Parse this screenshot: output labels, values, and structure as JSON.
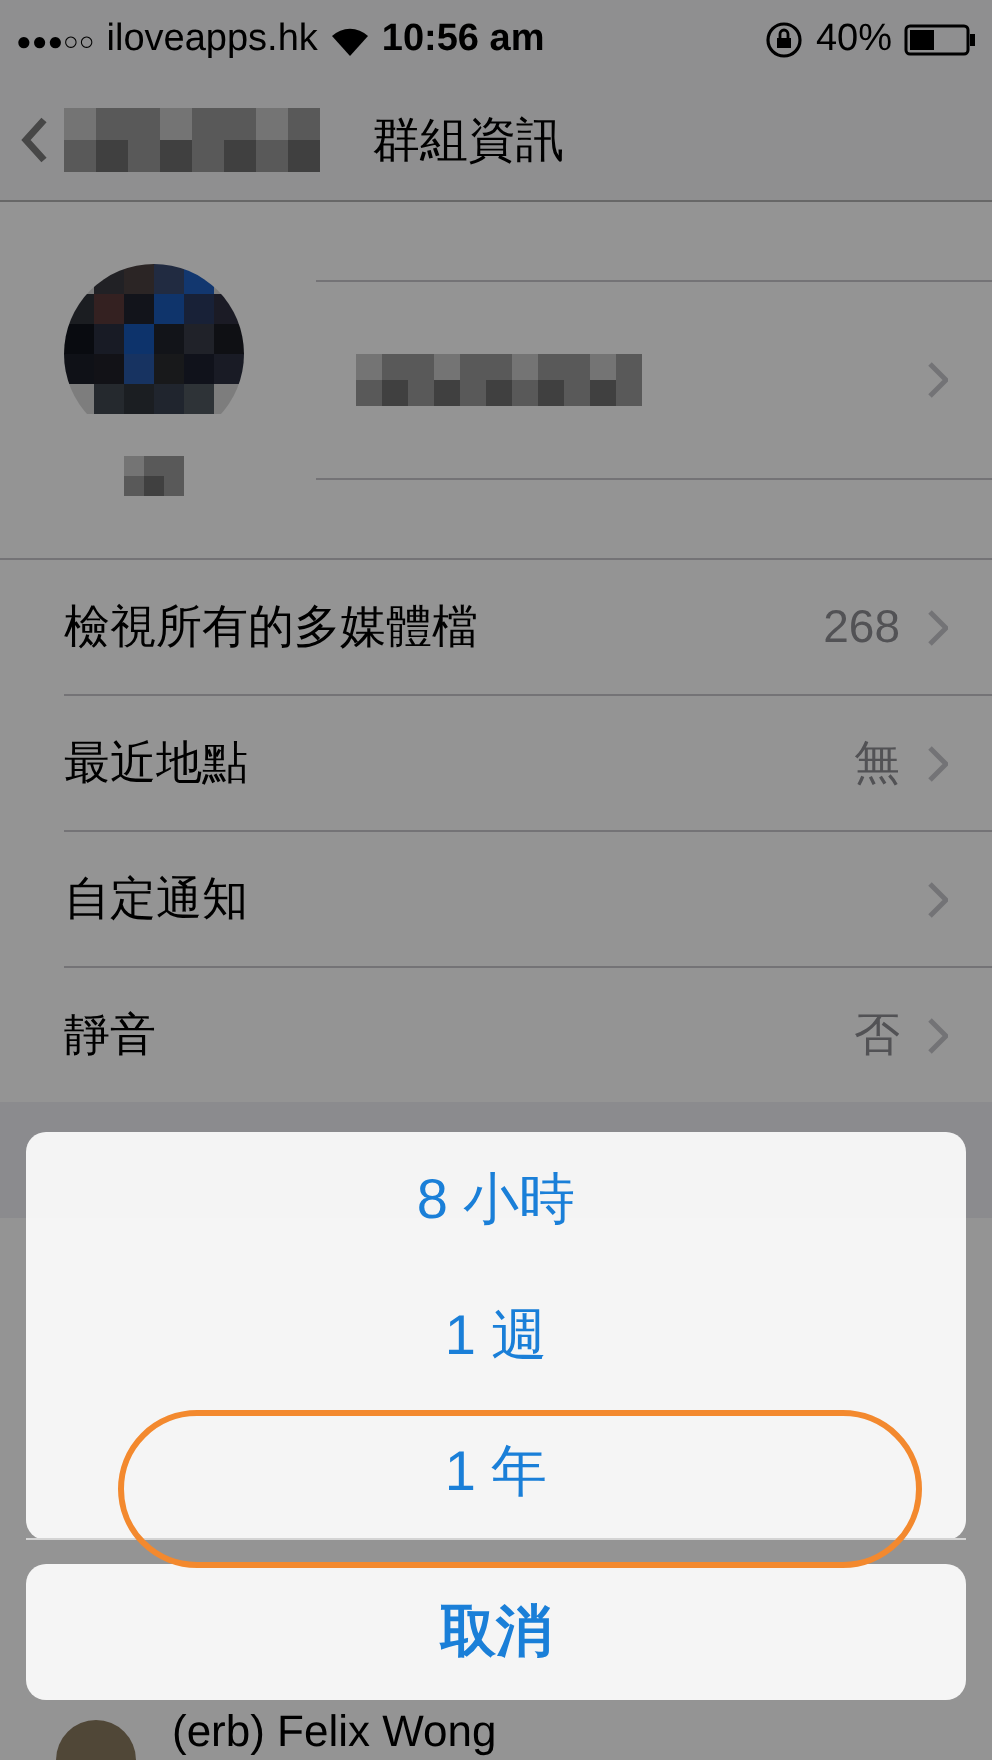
{
  "status_bar": {
    "signal": "●●●○○",
    "carrier": "iloveapps.hk",
    "time": "10:56 am",
    "battery": "40%"
  },
  "nav": {
    "title": "群組資訊"
  },
  "settings": [
    {
      "label": "檢視所有的多媒體檔",
      "value": "268"
    },
    {
      "label": "最近地點",
      "value": "無"
    },
    {
      "label": "自定通知"
    },
    {
      "label": "靜音",
      "value": "否"
    }
  ],
  "members": [
    {
      "name": "(erb) Felix Wong"
    }
  ],
  "action_sheet": {
    "options": [
      {
        "label": "8 小時",
        "selected": false
      },
      {
        "label": "1 週",
        "selected": false
      },
      {
        "label": "1 年",
        "selected": true
      }
    ],
    "cancel": "取消"
  }
}
